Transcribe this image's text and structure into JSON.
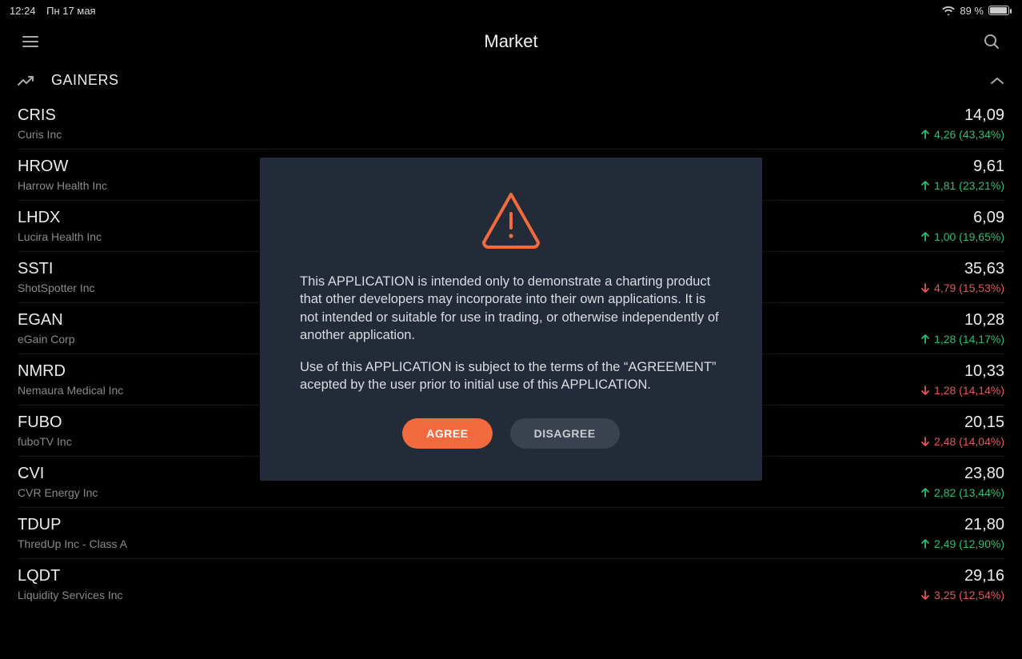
{
  "status": {
    "time": "12:24",
    "date": "Пн 17 мая",
    "battery_pct": "89 %"
  },
  "header": {
    "title": "Market"
  },
  "section": {
    "title": "GAINERS"
  },
  "stocks": [
    {
      "ticker": "CRIS",
      "company": "Curis Inc",
      "price": "14,09",
      "dir": "up",
      "change": "4,26 (43,34%)"
    },
    {
      "ticker": "HROW",
      "company": "Harrow Health Inc",
      "price": "9,61",
      "dir": "up",
      "change": "1,81 (23,21%)"
    },
    {
      "ticker": "LHDX",
      "company": "Lucira Health Inc",
      "price": "6,09",
      "dir": "up",
      "change": "1,00 (19,65%)"
    },
    {
      "ticker": "SSTI",
      "company": "ShotSpotter Inc",
      "price": "35,63",
      "dir": "down",
      "change": "4,79 (15,53%)"
    },
    {
      "ticker": "EGAN",
      "company": "eGain Corp",
      "price": "10,28",
      "dir": "up",
      "change": "1,28 (14,17%)"
    },
    {
      "ticker": "NMRD",
      "company": "Nemaura Medical Inc",
      "price": "10,33",
      "dir": "down",
      "change": "1,28 (14,14%)"
    },
    {
      "ticker": "FUBO",
      "company": "fuboTV Inc",
      "price": "20,15",
      "dir": "down",
      "change": "2,48 (14,04%)"
    },
    {
      "ticker": "CVI",
      "company": "CVR Energy Inc",
      "price": "23,80",
      "dir": "up",
      "change": "2,82 (13,44%)"
    },
    {
      "ticker": "TDUP",
      "company": "ThredUp Inc - Class A",
      "price": "21,80",
      "dir": "up",
      "change": "2,49 (12,90%)"
    },
    {
      "ticker": "LQDT",
      "company": "Liquidity Services Inc",
      "price": "29,16",
      "dir": "down",
      "change": "3,25 (12,54%)"
    }
  ],
  "modal": {
    "para1": "This APPLICATION is intended only to demonstrate a charting product that other developers may incorporate into their own applications. It is not intended or suitable for use in trading, or otherwise independently of another application.",
    "para2": "Use of this APPLICATION is subject to the terms of the “AGREEMENT” acepted by the user prior to initial use of this APPLICATION.",
    "agree": "AGREE",
    "disagree": "DISAGREE"
  },
  "colors": {
    "accent": "#f26a3e",
    "up": "#2fbf71",
    "down": "#e05a5a"
  }
}
